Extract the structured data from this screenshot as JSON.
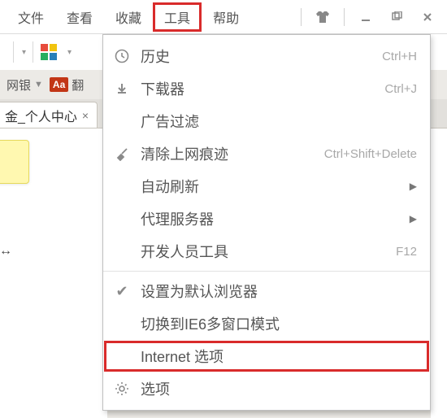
{
  "menubar": {
    "items": [
      "文件",
      "查看",
      "收藏",
      "工具",
      "帮助"
    ],
    "active_index": 3
  },
  "window_controls": {
    "shirt_icon": "shirt-icon",
    "minimize_icon": "minimize-icon",
    "maximize_icon": "maximize-icon",
    "close_icon": "close-icon"
  },
  "bookmark_bar": {
    "item1": "网银",
    "item2_suffix": "翻"
  },
  "tab": {
    "title_fragment": "金_个人中心",
    "close": "×"
  },
  "dropdown": {
    "items": [
      {
        "icon": "clock-icon",
        "label": "历史",
        "shortcut": "Ctrl+H"
      },
      {
        "icon": "download-icon",
        "label": "下载器",
        "shortcut": "Ctrl+J"
      },
      {
        "icon": "",
        "label": "广告过滤",
        "shortcut": ""
      },
      {
        "icon": "brush-icon",
        "label": "清除上网痕迹",
        "shortcut": "Ctrl+Shift+Delete"
      },
      {
        "icon": "",
        "label": "自动刷新",
        "submenu": true
      },
      {
        "icon": "",
        "label": "代理服务器",
        "submenu": true
      },
      {
        "icon": "",
        "label": "开发人员工具",
        "shortcut": "F12"
      },
      {
        "sep": true
      },
      {
        "icon": "check-icon",
        "label": "设置为默认浏览器",
        "shortcut": ""
      },
      {
        "icon": "",
        "label": "切换到IE6多窗口模式",
        "shortcut": ""
      },
      {
        "icon": "",
        "label": "Internet 选项",
        "highlight": true
      },
      {
        "icon": "gear-icon",
        "label": "选项",
        "shortcut": ""
      }
    ]
  }
}
